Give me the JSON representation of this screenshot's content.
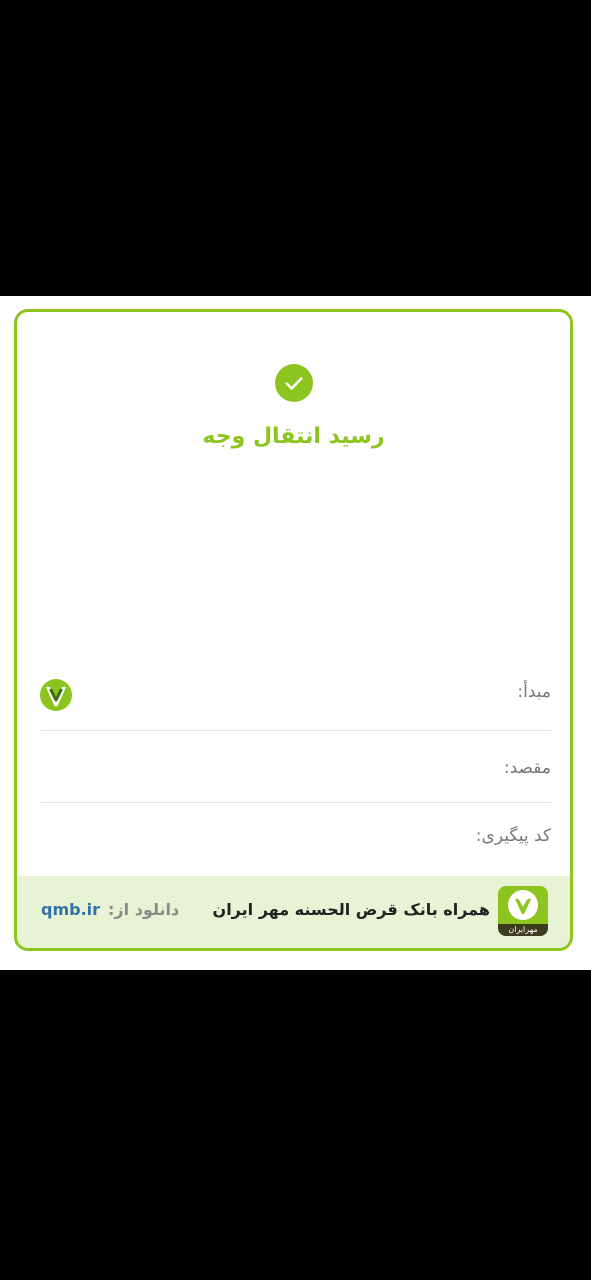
{
  "receipt": {
    "title": "رسید انتقال وجه",
    "success_icon": "check-circle-icon",
    "rows": [
      {
        "label": "مبدأ:",
        "value_icon": "bank-check-icon"
      },
      {
        "label": "مقصد:"
      },
      {
        "label": "کد پیگیری:"
      }
    ]
  },
  "footer": {
    "app_name": "همراه بانک قرض الحسنه مهر ایران",
    "logo_text": "مهرایران",
    "download_label": "دانلود از:",
    "download_link": "qmb.ir"
  },
  "colors": {
    "accent": "#8cc51f",
    "footer_bg": "#e8f2d4",
    "link": "#2f74a8",
    "logo_band": "#3c3c1e"
  }
}
